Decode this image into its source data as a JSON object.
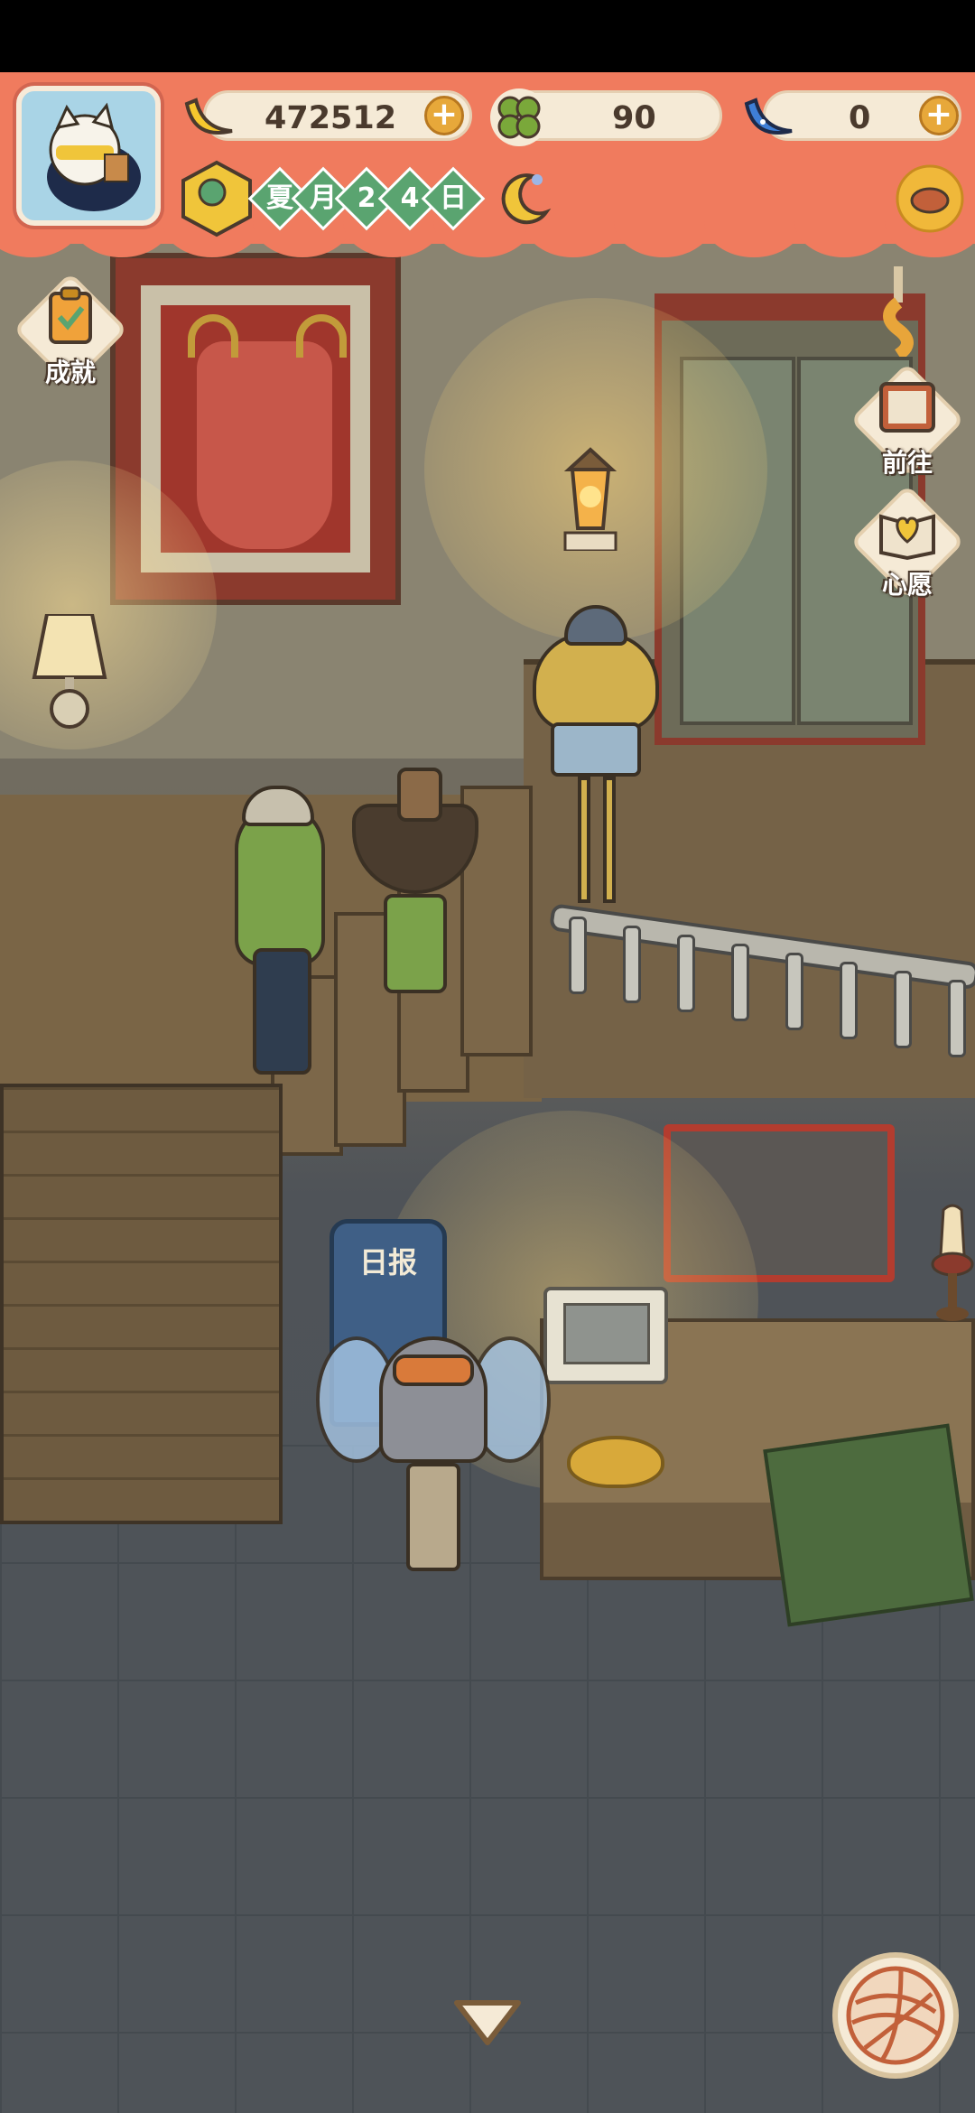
{
  "hud": {
    "bananas": "472512",
    "clovers": "90",
    "blue_bananas": "0",
    "season": "夏",
    "month_char": "月",
    "day_digit_1": "2",
    "day_digit_2": "4",
    "day_char": "日",
    "time_of_day_icon": "moon-icon"
  },
  "side_buttons": {
    "achievements": "成就",
    "go_to": "前往",
    "wish": "心愿"
  },
  "scene": {
    "sign_text": "日报"
  },
  "colors": {
    "hud_bg": "#f07b5e",
    "pill_bg": "#f5ead6",
    "plus": "#e7a83a",
    "date_green": "#5aa470"
  }
}
